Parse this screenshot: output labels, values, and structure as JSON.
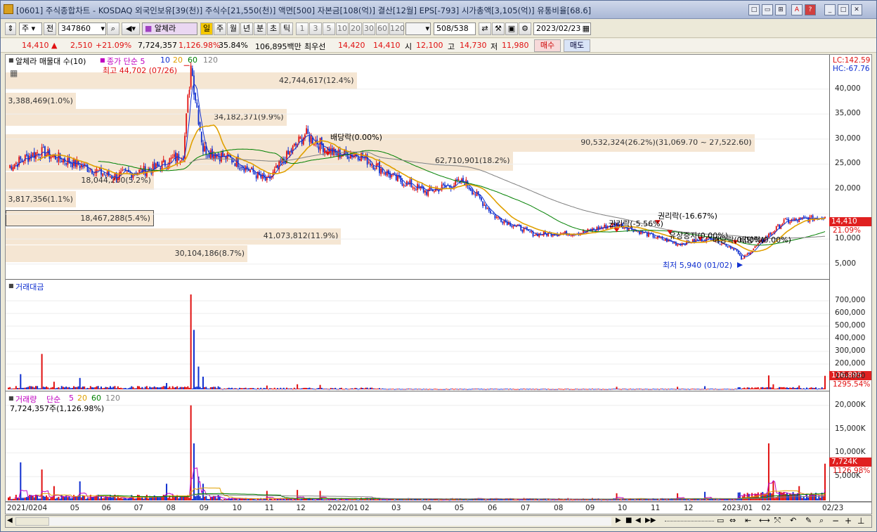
{
  "window": {
    "title": "[0601] 주식종합차트 - KOSDAQ 외국인보유[39(천)] 주식수[21,550(천)] 액면[500] 자본금[108(억)] 결산[12월] EPS[-793] 시가총액[3,105(억)] 유통비율[68.6]",
    "buttons": [
      "□",
      "▭",
      "⊞",
      "A",
      "?",
      "_",
      "□",
      "✕"
    ]
  },
  "toolbar": {
    "market": "주",
    "prev": "전",
    "code": "347860",
    "name": "알체라",
    "periods": [
      "일",
      "주",
      "월",
      "년",
      "분",
      "초",
      "틱"
    ],
    "intervals": [
      "1",
      "3",
      "5",
      "10",
      "20",
      "30",
      "60",
      "120"
    ],
    "count": "508",
    "total": "/538",
    "date": "2023/02/23"
  },
  "quote": {
    "price": "14,410",
    "arrow": "▲",
    "change": "2,510",
    "rate": "+21.09%",
    "volume": "7,724,357",
    "vol_rate": "1,126.98%",
    "turnover": "35.84%",
    "amount": "106,895백만",
    "best_ask_label": "최우선",
    "ask": "14,420",
    "bid": "14,410",
    "open_label": "시",
    "open": "12,100",
    "high_label": "고",
    "high": "14,730",
    "low_label": "저",
    "low": "11,980",
    "buy": "매수",
    "sell": "매도"
  },
  "price_pane": {
    "title": "알체라 매물대 수(10)",
    "legend": [
      "종가 단순 5",
      "10",
      "20",
      "60",
      "120"
    ],
    "lc": "LC:142.59",
    "hc": "HC:-67.76",
    "high_note": "최고 44,702 (07/26)",
    "low_note": "최저 5,940 (01/02)",
    "current_price": "14,410",
    "current_rate": "21.09%",
    "events": [
      "배당락(0.00%)",
      "권리락(-5.56%)",
      "권리락(-16.67%)",
      "유상증자(0.00%)",
      "배당락(0.00%)",
      "배당락(0.00%)"
    ],
    "volume_profile": [
      {
        "label": "42,744,617(12.4%)",
        "from": 40000,
        "to": 43300,
        "frac": 0.45
      },
      {
        "label": "3,388,469(1.0%)",
        "from": 35900,
        "to": 39200,
        "frac": 0.09
      },
      {
        "label": "34,182,371(9.9%)",
        "from": 32700,
        "to": 36000,
        "frac": 0.36
      },
      {
        "label": "90,532,324(26.2%)(31,069.70 ~ 27,522.60)",
        "from": 27500,
        "to": 31000,
        "frac": 0.96
      },
      {
        "label": "62,710,901(18.2%)",
        "from": 23700,
        "to": 27400,
        "frac": 0.65
      },
      {
        "label": "18,044,260(5.2%)",
        "from": 19900,
        "to": 23400,
        "frac": 0.19
      },
      {
        "label": "3,817,356(1.1%)",
        "from": 16300,
        "to": 19600,
        "frac": 0.09
      },
      {
        "label": "18,467,288(5.4%)",
        "from": 12600,
        "to": 15800,
        "frac": 0.19
      },
      {
        "label": "41,073,812(11.9%)",
        "from": 8900,
        "to": 12100,
        "frac": 0.43
      },
      {
        "label": "30,104,186(8.7%)",
        "from": 5400,
        "to": 8700,
        "frac": 0.31
      }
    ],
    "yticks": [
      "40,000",
      "35,000",
      "30,000",
      "25,000",
      "20,000",
      "15,000",
      "10,000",
      "5,000"
    ]
  },
  "amount_pane": {
    "title": "거래대금",
    "current": "106,895",
    "rate": "1295.54%",
    "yticks": [
      "700,000",
      "600,000",
      "500,000",
      "400,000",
      "300,000",
      "200,000",
      "100,000"
    ]
  },
  "volume_pane": {
    "title": "거래량 단순 5 20 60 120",
    "title_parts": [
      "거래량",
      "단순",
      "5",
      "20",
      "60",
      "120"
    ],
    "value": "7,724,357주(1,126.98%)",
    "current": "7,724K",
    "rate": "1126.98%",
    "yticks": [
      "20,000K",
      "15,000K",
      "10,000K",
      "5,000K"
    ]
  },
  "xaxis": [
    "2021/02",
    "04",
    "05",
    "06",
    "07",
    "08",
    "09",
    "10",
    "11",
    "12",
    "2022/01",
    "02",
    "03",
    "04",
    "05",
    "06",
    "07",
    "08",
    "09",
    "10",
    "11",
    "12",
    "2023/01",
    "02",
    "02/23"
  ],
  "colors": {
    "up": "#e01010",
    "down": "#1030d0",
    "ma5": "#1030d0",
    "ma10": "#c000c0",
    "ma20": "#e0a000",
    "ma60": "#008000",
    "ma120": "#808080",
    "vp": "#f5e6d3"
  },
  "chart_data": [
    {
      "type": "line",
      "note_series": "price (won), daily candlesticks approximated by closing-price key points; 0 = 2021/02/01, 537 = 2023/02/23",
      "x_dates": [
        "2021-02",
        "2021-03",
        "2021-04",
        "2021-05",
        "2021-06",
        "2021-07",
        "2021-07-26",
        "2021-08",
        "2021-09",
        "2021-10",
        "2021-11",
        "2021-12",
        "2022-01",
        "2022-02",
        "2022-03",
        "2022-04",
        "2022-05",
        "2022-06",
        "2022-07",
        "2022-08",
        "2022-09",
        "2022-10",
        "2022-11",
        "2022-12",
        "2023-01-02",
        "2023-02",
        "2023-02-23"
      ],
      "series": [
        {
          "name": "종가",
          "values": [
            24500,
            27500,
            25000,
            22500,
            24000,
            27000,
            44702,
            28000,
            25500,
            21500,
            31000,
            27000,
            27000,
            22000,
            19500,
            21500,
            14500,
            11000,
            11200,
            13000,
            11000,
            9000,
            10200,
            8000,
            5940,
            13500,
            14410
          ]
        }
      ],
      "ylim": [
        3000,
        46000
      ]
    },
    {
      "type": "bar",
      "title": "거래대금",
      "note_series": "trading value (million won); key spikes only",
      "x_dates": [
        "2021-02",
        "2021-03",
        "2021-07-26",
        "2021-08",
        "2021-11",
        "2022-02",
        "2023-02-23"
      ],
      "values": [
        120000,
        280000,
        750000,
        470000,
        100000,
        30000,
        106895
      ],
      "ylim": [
        0,
        800000
      ]
    },
    {
      "type": "bar",
      "title": "거래량",
      "note_series": "volume (K shares); key spikes only",
      "x_dates": [
        "2021-02",
        "2021-03",
        "2021-07-26",
        "2021-08",
        "2021-11",
        "2023-01",
        "2023-02-23"
      ],
      "values": [
        8000,
        6500,
        20000,
        12000,
        2000,
        12000,
        7724
      ],
      "ylim": [
        0,
        21000
      ]
    }
  ]
}
